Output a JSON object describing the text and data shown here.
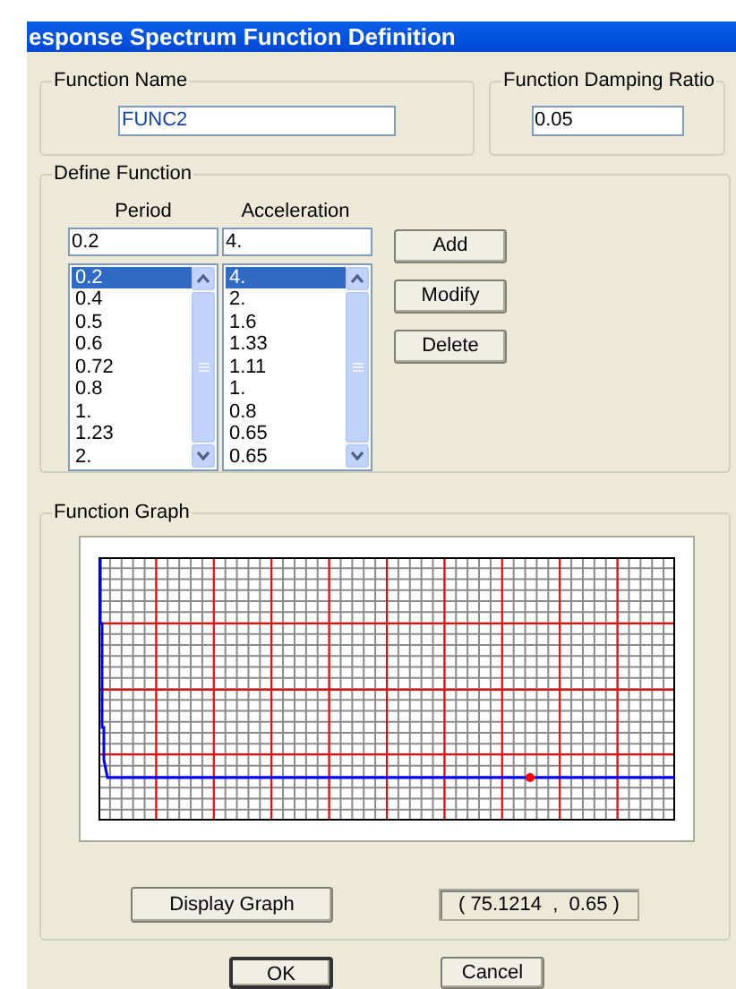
{
  "window": {
    "title": "esponse Spectrum  Function Definition"
  },
  "function_name": {
    "label": "Function Name",
    "value": "FUNC2"
  },
  "damping": {
    "label": "Function Damping Ratio",
    "value": "0.05"
  },
  "define_function": {
    "label": "Define Function",
    "period_label": "Period",
    "acceleration_label": "Acceleration",
    "period_value": "0.2",
    "acceleration_value": "4.",
    "periods": [
      {
        "text": "0.2",
        "selected": true
      },
      {
        "text": "0.4",
        "selected": false
      },
      {
        "text": "0.5",
        "selected": false
      },
      {
        "text": "0.6",
        "selected": false
      },
      {
        "text": "0.72",
        "selected": false
      },
      {
        "text": "0.8",
        "selected": false
      },
      {
        "text": "1.",
        "selected": false
      },
      {
        "text": "1.23",
        "selected": false
      },
      {
        "text": "2.",
        "selected": false
      }
    ],
    "accelerations": [
      {
        "text": "4.",
        "selected": true
      },
      {
        "text": "2.",
        "selected": false
      },
      {
        "text": "1.6",
        "selected": false
      },
      {
        "text": "1.33",
        "selected": false
      },
      {
        "text": "1.11",
        "selected": false
      },
      {
        "text": "1.",
        "selected": false
      },
      {
        "text": "0.8",
        "selected": false
      },
      {
        "text": "0.65",
        "selected": false
      },
      {
        "text": "0.65",
        "selected": false
      }
    ],
    "buttons": [
      "Add",
      "Modify",
      "Delete"
    ]
  },
  "function_graph": {
    "label": "Function Graph",
    "button": "Display Graph",
    "readout": "( 75.1214  ,  0.65 )"
  },
  "buttons": [
    {
      "label": "OK",
      "default": true
    },
    {
      "label": "Cancel",
      "default": false
    }
  ]
}
